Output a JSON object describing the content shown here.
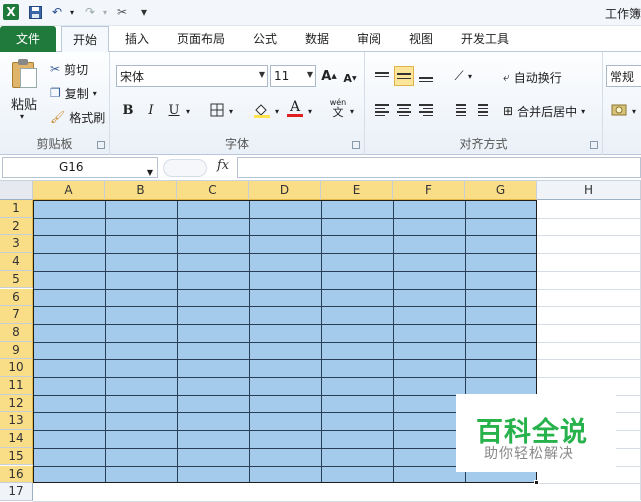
{
  "quick_access": {
    "dropdown_glyph": "▾"
  },
  "window_title": "工作簿",
  "tabs": [
    "文件",
    "开始",
    "插入",
    "页面布局",
    "公式",
    "数据",
    "审阅",
    "视图",
    "开发工具"
  ],
  "clipboard": {
    "paste": "粘贴",
    "cut": "剪切",
    "copy": "复制",
    "format_painter": "格式刷",
    "group_label": "剪贴板"
  },
  "font": {
    "name": "宋体",
    "size": "11",
    "bold": "B",
    "italic": "I",
    "underline": "U",
    "wen": "wén\n文",
    "group_label": "字体",
    "font_color": "#e02020"
  },
  "alignment": {
    "wrap_text": "自动换行",
    "merge_center": "合并后居中",
    "group_label": "对齐方式"
  },
  "number": {
    "format": "常规"
  },
  "formula_bar": {
    "name_box": "G16",
    "fx": "fx",
    "content": ""
  },
  "columns": [
    "A",
    "B",
    "C",
    "D",
    "E",
    "F",
    "G",
    "H"
  ],
  "rows": [
    "1",
    "2",
    "3",
    "4",
    "5",
    "6",
    "7",
    "8",
    "9",
    "10",
    "11",
    "12",
    "13",
    "14",
    "15",
    "16",
    "17"
  ],
  "selection": {
    "range": "A1:G16",
    "fill_color": "#a4cbec"
  },
  "watermark": {
    "title": "百科全说",
    "subtitle": "助你轻松解决"
  }
}
